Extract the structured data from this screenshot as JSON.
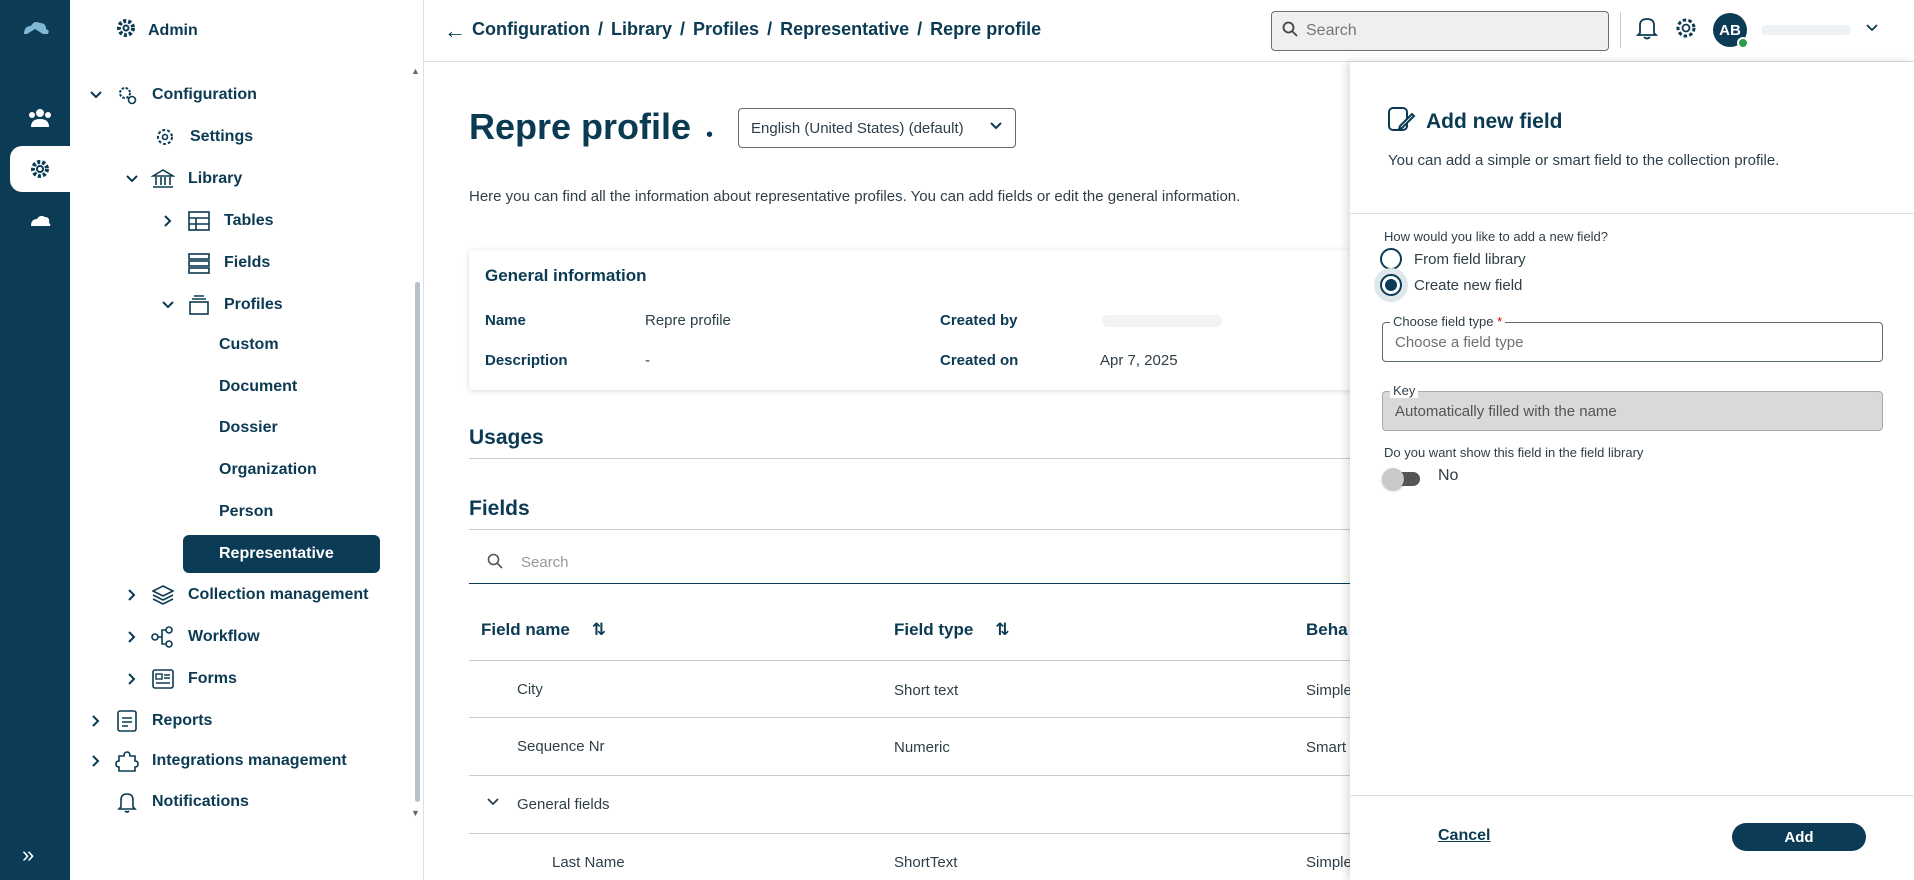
{
  "sidebar": {
    "header": "Admin",
    "items": {
      "configuration": "Configuration",
      "settings": "Settings",
      "library": "Library",
      "tables": "Tables",
      "fields": "Fields",
      "profiles": "Profiles",
      "custom": "Custom",
      "document": "Document",
      "dossier": "Dossier",
      "organization": "Organization",
      "person": "Person",
      "representative": "Representative",
      "collection_management": "Collection management",
      "workflow": "Workflow",
      "forms": "Forms",
      "reports": "Reports",
      "integrations_management": "Integrations management",
      "notifications": "Notifications"
    }
  },
  "topbar": {
    "breadcrumb": [
      "Configuration",
      "/",
      "Library",
      "/",
      "Profiles",
      "/",
      "Representative",
      "/",
      "Repre profile"
    ],
    "search_placeholder": "Search",
    "avatar_initials": "AB"
  },
  "main": {
    "title": "Repre profile",
    "title_dot": "•",
    "language": "English (United States) (default)",
    "intro": "Here you can find all the information about representative profiles. You can add fields or edit the general information.",
    "general": {
      "title": "General information",
      "name_label": "Name",
      "name_value": "Repre profile",
      "description_label": "Description",
      "description_value": "-",
      "created_by_label": "Created by",
      "created_on_label": "Created on",
      "created_on_value": "Apr 7, 2025"
    },
    "usages_title": "Usages",
    "fields_title": "Fields",
    "fields_search_placeholder": "Search",
    "columns": [
      "Field name",
      "Field type",
      "Beha"
    ],
    "rows": [
      {
        "name": "City",
        "type": "Short text",
        "behavior": "Simple"
      },
      {
        "name": "Sequence Nr",
        "type": "Numeric",
        "behavior": "Smart"
      },
      {
        "name": "General fields",
        "type": "",
        "behavior": ""
      },
      {
        "name": "Last Name",
        "type": "ShortText",
        "behavior": "Simple"
      }
    ]
  },
  "drawer": {
    "title": "Add new field",
    "subtitle": "You can add a simple or smart field to the collection profile.",
    "question": "How would you like to add a new field?",
    "option_library": "From field library",
    "option_create": "Create new field",
    "field_type_label": "Choose field type",
    "field_type_required": "*",
    "field_type_placeholder": "Choose a field type",
    "key_label": "Key",
    "key_value": "Automatically filled with the name",
    "show_question": "Do you want show this field in the field library",
    "toggle_label": "No",
    "cancel": "Cancel",
    "add": "Add"
  },
  "colors": {
    "primary": "#0c3c55",
    "accent_green": "#2a9d4a",
    "required": "#cc0000"
  }
}
